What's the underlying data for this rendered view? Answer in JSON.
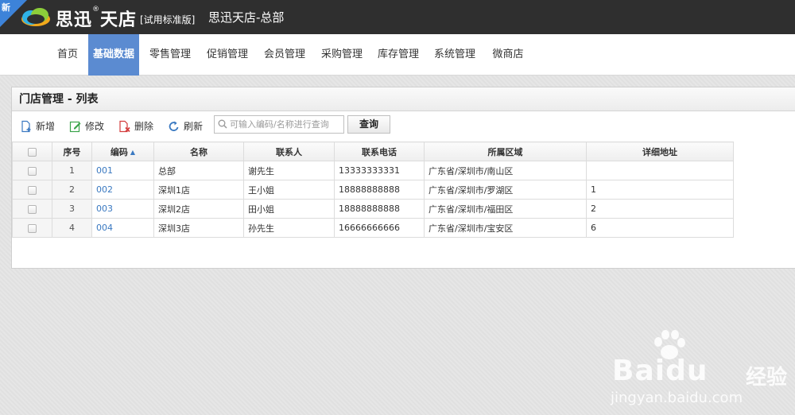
{
  "header": {
    "new_badge": "新",
    "logo_text": "思迅",
    "logo_reg": "®",
    "logo_text2": "天店",
    "edition": "[试用标准版]",
    "store_title": "思迅天店-总部"
  },
  "nav": {
    "items": [
      {
        "label": "首页"
      },
      {
        "label": "基础数据"
      },
      {
        "label": "零售管理"
      },
      {
        "label": "促销管理"
      },
      {
        "label": "会员管理"
      },
      {
        "label": "采购管理"
      },
      {
        "label": "库存管理"
      },
      {
        "label": "系统管理"
      },
      {
        "label": "微商店"
      }
    ],
    "active_index": 1
  },
  "panel": {
    "title": "门店管理 - 列表"
  },
  "toolbar": {
    "add": "新增",
    "edit": "修改",
    "delete": "删除",
    "refresh": "刷新",
    "search_placeholder": "可输入编码/名称进行查询",
    "query": "查询"
  },
  "table": {
    "headers": {
      "index": "序号",
      "code": "编码",
      "name": "名称",
      "contact": "联系人",
      "phone": "联系电话",
      "region": "所属区域",
      "address": "详细地址"
    },
    "sort_column": "code",
    "rows": [
      {
        "index": "1",
        "code": "001",
        "name": "总部",
        "contact": "谢先生",
        "phone": "13333333331",
        "region": "广东省/深圳市/南山区",
        "address": ""
      },
      {
        "index": "2",
        "code": "002",
        "name": "深圳1店",
        "contact": "王小姐",
        "phone": "18888888888",
        "region": "广东省/深圳市/罗湖区",
        "address": "1"
      },
      {
        "index": "3",
        "code": "003",
        "name": "深圳2店",
        "contact": "田小姐",
        "phone": "18888888888",
        "region": "广东省/深圳市/福田区",
        "address": "2"
      },
      {
        "index": "4",
        "code": "004",
        "name": "深圳3店",
        "contact": "孙先生",
        "phone": "16666666666",
        "region": "广东省/深圳市/宝安区",
        "address": "6"
      }
    ]
  },
  "watermark": {
    "brand": "Baidu",
    "brand_cn": "经验",
    "url": "jingyan.baidu.com"
  },
  "colors": {
    "topbar": "#2f2f2f",
    "nav_active": "#5b8bd1",
    "link": "#3a79c1"
  }
}
